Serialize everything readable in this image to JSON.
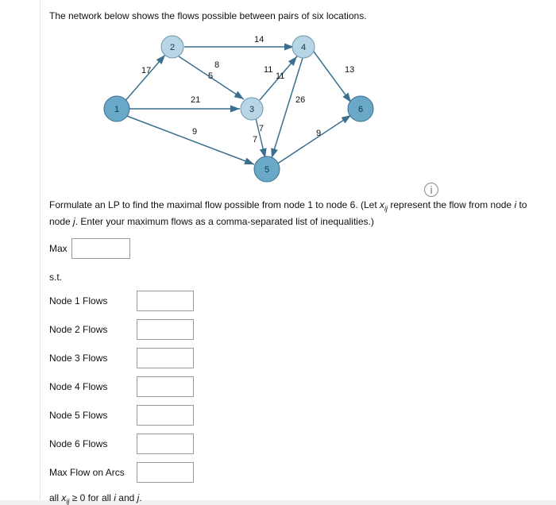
{
  "intro": "The network below shows the flows possible between pairs of six locations.",
  "formulate_pre": "Formulate an LP to find the maximal flow possible from node 1 to node 6. (Let ",
  "formulate_var_x": "x",
  "formulate_sub_ij": "ij",
  "formulate_post": " represent the flow from node ",
  "formulate_i": "i",
  "formulate_to": " to node ",
  "formulate_j": "j",
  "formulate_end": ". Enter your maximum flows as a comma-separated list of inequalities.)",
  "obj_label": "Max",
  "st_label": "s.t.",
  "rows": {
    "n1": "Node 1 Flows",
    "n2": "Node 2 Flows",
    "n3": "Node 3 Flows",
    "n4": "Node 4 Flows",
    "n5": "Node 5 Flows",
    "n6": "Node 6 Flows",
    "arcs": "Max Flow on Arcs"
  },
  "nonneg_pre": "all ",
  "nonneg_x": "x",
  "nonneg_sub": "ij",
  "nonneg_mid": " ≥ 0 for all ",
  "nonneg_i": "i",
  "nonneg_and": " and ",
  "nonneg_j": "j",
  "nonneg_end": ".",
  "info_icon": "i",
  "diagram": {
    "nodes": {
      "1": "1",
      "2": "2",
      "3": "3",
      "4": "4",
      "5": "5",
      "6": "6"
    },
    "edge_labels": {
      "e12": "17",
      "e13": "21",
      "e15": "9",
      "e23": "5",
      "e28": "8",
      "e24": "14",
      "e34": "11",
      "e3411": "11",
      "e35": "7",
      "e357": "7",
      "e46": "13",
      "e45": "26",
      "e56": "9"
    }
  },
  "chart_data": {
    "type": "diagram",
    "description": "Directed flow network with six nodes",
    "nodes": [
      1,
      2,
      3,
      4,
      5,
      6
    ],
    "edges": [
      {
        "from": 1,
        "to": 2,
        "capacity": 17
      },
      {
        "from": 1,
        "to": 3,
        "capacity": 21
      },
      {
        "from": 1,
        "to": 5,
        "capacity": 9
      },
      {
        "from": 2,
        "to": 3,
        "capacity": 5
      },
      {
        "from": 2,
        "to": 3,
        "label_extra": 8
      },
      {
        "from": 2,
        "to": 4,
        "capacity": 14
      },
      {
        "from": 3,
        "to": 4,
        "capacity": 11
      },
      {
        "from": 3,
        "to": 4,
        "label_extra": 11
      },
      {
        "from": 3,
        "to": 5,
        "capacity": 7
      },
      {
        "from": 3,
        "to": 5,
        "label_extra": 7
      },
      {
        "from": 4,
        "to": 5,
        "capacity": 26
      },
      {
        "from": 4,
        "to": 6,
        "capacity": 13
      },
      {
        "from": 5,
        "to": 6,
        "capacity": 9
      }
    ]
  }
}
